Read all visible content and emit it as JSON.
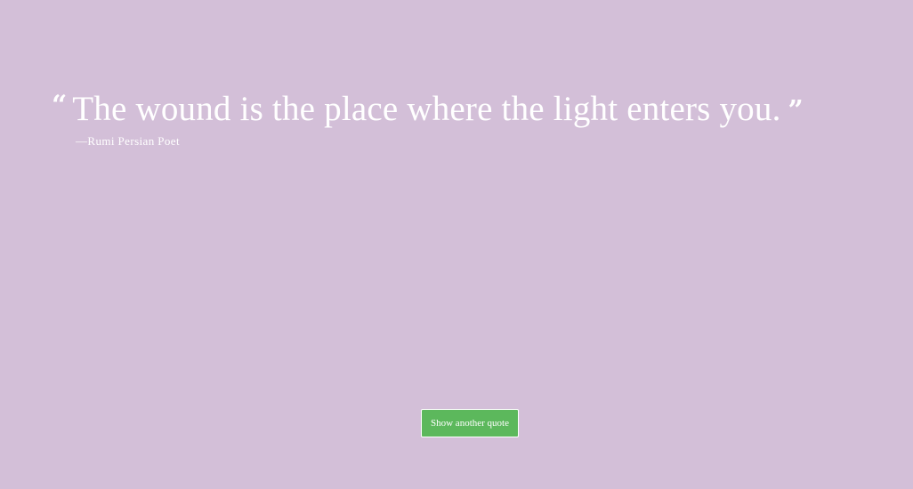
{
  "quote": {
    "open_mark": "“",
    "text": "The wound is the place where the light enters you.",
    "close_mark": "”",
    "author": "—Rumi Persian Poet"
  },
  "actions": {
    "next_label": "Show another quote"
  },
  "colors": {
    "background": "#d3bfd8",
    "text": "#ffffff",
    "button": "#5cb85c"
  }
}
